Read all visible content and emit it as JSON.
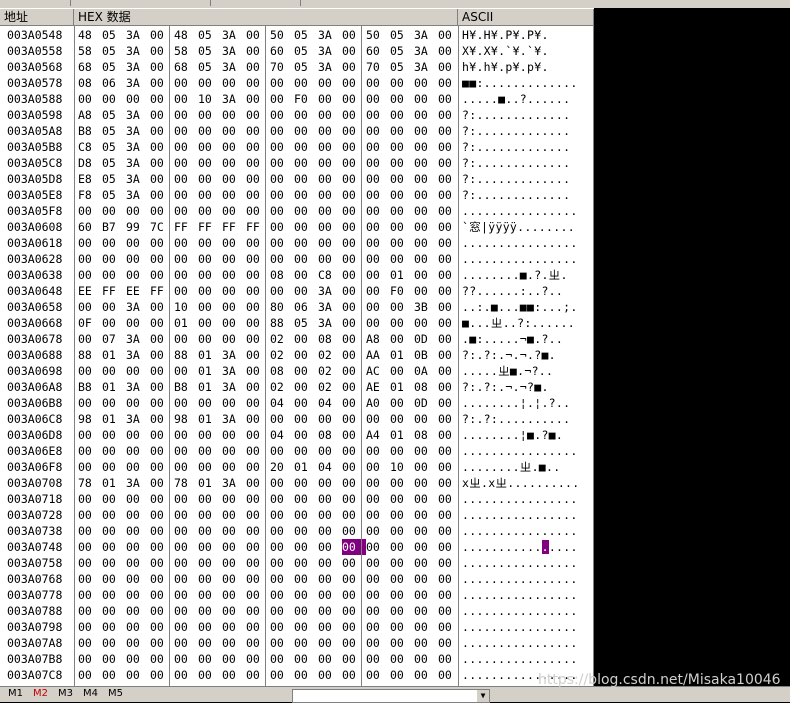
{
  "header": {
    "address": "地址",
    "hex": "HEX 数据",
    "ascii": "ASCII"
  },
  "rows": [
    {
      "addr": "003A0548",
      "bytes": "48 05 3A 00 48 05 3A 00 50 05 3A 00 50 05 3A 00",
      "ascii": "H¥.H¥.P¥.P¥."
    },
    {
      "addr": "003A0558",
      "bytes": "58 05 3A 00 58 05 3A 00 60 05 3A 00 60 05 3A 00",
      "ascii": "X¥.X¥.`¥.`¥."
    },
    {
      "addr": "003A0568",
      "bytes": "68 05 3A 00 68 05 3A 00 70 05 3A 00 70 05 3A 00",
      "ascii": "h¥.h¥.p¥.p¥."
    },
    {
      "addr": "003A0578",
      "bytes": "08 06 3A 00 00 00 00 00 00 00 00 00 00 00 00 00",
      "ascii": "■■:............."
    },
    {
      "addr": "003A0588",
      "bytes": "00 00 00 00 00 10 3A 00 00 F0 00 00 00 00 00 00",
      "ascii": ".....■..?......"
    },
    {
      "addr": "003A0598",
      "bytes": "A8 05 3A 00 00 00 00 00 00 00 00 00 00 00 00 00",
      "ascii": "?:............."
    },
    {
      "addr": "003A05A8",
      "bytes": "B8 05 3A 00 00 00 00 00 00 00 00 00 00 00 00 00",
      "ascii": "?:............."
    },
    {
      "addr": "003A05B8",
      "bytes": "C8 05 3A 00 00 00 00 00 00 00 00 00 00 00 00 00",
      "ascii": "?:............."
    },
    {
      "addr": "003A05C8",
      "bytes": "D8 05 3A 00 00 00 00 00 00 00 00 00 00 00 00 00",
      "ascii": "?:............."
    },
    {
      "addr": "003A05D8",
      "bytes": "E8 05 3A 00 00 00 00 00 00 00 00 00 00 00 00 00",
      "ascii": "?:............."
    },
    {
      "addr": "003A05E8",
      "bytes": "F8 05 3A 00 00 00 00 00 00 00 00 00 00 00 00 00",
      "ascii": "?:............."
    },
    {
      "addr": "003A05F8",
      "bytes": "00 00 00 00 00 00 00 00 00 00 00 00 00 00 00 00",
      "ascii": "................"
    },
    {
      "addr": "003A0608",
      "bytes": "60 B7 99 7C FF FF FF FF 00 00 00 00 00 00 00 00",
      "ascii": "`窓|ÿÿÿÿ........"
    },
    {
      "addr": "003A0618",
      "bytes": "00 00 00 00 00 00 00 00 00 00 00 00 00 00 00 00",
      "ascii": "................"
    },
    {
      "addr": "003A0628",
      "bytes": "00 00 00 00 00 00 00 00 00 00 00 00 00 00 00 00",
      "ascii": "................"
    },
    {
      "addr": "003A0638",
      "bytes": "00 00 00 00 00 00 00 00 08 00 C8 00 00 01 00 00",
      "ascii": "........■.?.ㄓ."
    },
    {
      "addr": "003A0648",
      "bytes": "EE FF EE FF 00 00 00 00 00 00 3A 00 00 F0 00 00",
      "ascii": "??......:..?.."
    },
    {
      "addr": "003A0658",
      "bytes": "00 00 3A 00 10 00 00 00 80 06 3A 00 00 00 3B 00",
      "ascii": "..:.■...■■:...;."
    },
    {
      "addr": "003A0668",
      "bytes": "0F 00 00 00 01 00 00 00 88 05 3A 00 00 00 00 00",
      "ascii": "■...ㄓ..?:......"
    },
    {
      "addr": "003A0678",
      "bytes": "00 07 3A 00 00 00 00 00 02 00 08 00 A8 00 0D 00",
      "ascii": ".■:.....¬■.?.."
    },
    {
      "addr": "003A0688",
      "bytes": "88 01 3A 00 88 01 3A 00 02 00 02 00 AA 01 0B 00",
      "ascii": "?:.?:.¬.¬.?■."
    },
    {
      "addr": "003A0698",
      "bytes": "00 00 00 00 00 01 3A 00 08 00 02 00 AC 00 0A 00",
      "ascii": ".....ㄓ■.¬?.."
    },
    {
      "addr": "003A06A8",
      "bytes": "B8 01 3A 00 B8 01 3A 00 02 00 02 00 AE 01 08 00",
      "ascii": "?:.?:.¬.¬?■."
    },
    {
      "addr": "003A06B8",
      "bytes": "00 00 00 00 00 00 00 00 04 00 04 00 A0 00 0D 00",
      "ascii": "........¦.¦.?.."
    },
    {
      "addr": "003A06C8",
      "bytes": "98 01 3A 00 98 01 3A 00 00 00 00 00 00 00 00 00",
      "ascii": "?:.?:.........."
    },
    {
      "addr": "003A06D8",
      "bytes": "00 00 00 00 00 00 00 00 04 00 08 00 A4 01 08 00",
      "ascii": "........¦■.?■."
    },
    {
      "addr": "003A06E8",
      "bytes": "00 00 00 00 00 00 00 00 00 00 00 00 00 00 00 00",
      "ascii": "................"
    },
    {
      "addr": "003A06F8",
      "bytes": "00 00 00 00 00 00 00 00 20 01 04 00 00 10 00 00",
      "ascii": "........ㄓ.■.."
    },
    {
      "addr": "003A0708",
      "bytes": "78 01 3A 00 78 01 3A 00 00 00 00 00 00 00 00 00",
      "ascii": "xㄓ.xㄓ.........."
    },
    {
      "addr": "003A0718",
      "bytes": "00 00 00 00 00 00 00 00 00 00 00 00 00 00 00 00",
      "ascii": "................"
    },
    {
      "addr": "003A0728",
      "bytes": "00 00 00 00 00 00 00 00 00 00 00 00 00 00 00 00",
      "ascii": "................"
    },
    {
      "addr": "003A0738",
      "bytes": "00 00 00 00 00 00 00 00 00 00 00 00 00 00 00 00",
      "ascii": "................"
    },
    {
      "addr": "003A0748",
      "bytes": "00 00 00 00 00 00 00 00 00 00 00 00 00 00 00 00",
      "ascii": "................",
      "sel": 11
    },
    {
      "addr": "003A0758",
      "bytes": "00 00 00 00 00 00 00 00 00 00 00 00 00 00 00 00",
      "ascii": "................"
    },
    {
      "addr": "003A0768",
      "bytes": "00 00 00 00 00 00 00 00 00 00 00 00 00 00 00 00",
      "ascii": "................"
    },
    {
      "addr": "003A0778",
      "bytes": "00 00 00 00 00 00 00 00 00 00 00 00 00 00 00 00",
      "ascii": "................"
    },
    {
      "addr": "003A0788",
      "bytes": "00 00 00 00 00 00 00 00 00 00 00 00 00 00 00 00",
      "ascii": "................"
    },
    {
      "addr": "003A0798",
      "bytes": "00 00 00 00 00 00 00 00 00 00 00 00 00 00 00 00",
      "ascii": "................"
    },
    {
      "addr": "003A07A8",
      "bytes": "00 00 00 00 00 00 00 00 00 00 00 00 00 00 00 00",
      "ascii": "................"
    },
    {
      "addr": "003A07B8",
      "bytes": "00 00 00 00 00 00 00 00 00 00 00 00 00 00 00 00",
      "ascii": "................"
    },
    {
      "addr": "003A07C8",
      "bytes": "00 00 00 00 00 00 00 00 00 00 00 00 00 00 00 00",
      "ascii": "................"
    }
  ],
  "tabs": [
    "M1",
    "M2",
    "M3",
    "M4",
    "M5"
  ],
  "active_tab": 1,
  "watermark": "https://blog.csdn.net/Misaka10046",
  "colors": {
    "selection": "#800080",
    "panel": "#ffffff",
    "chrome": "#d4d0c8"
  }
}
